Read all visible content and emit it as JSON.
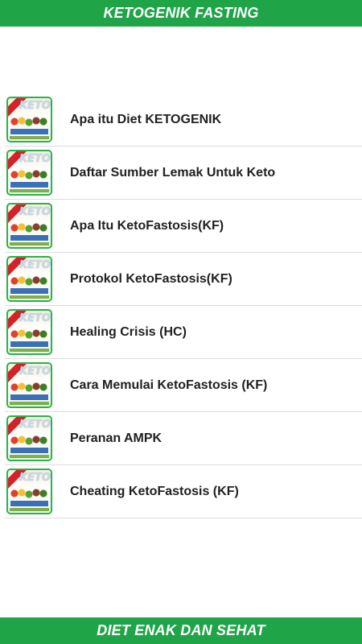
{
  "header": {
    "title": "KETOGENIK FASTING"
  },
  "menu": {
    "items": [
      {
        "label": "Apa itu Diet KETOGENIK"
      },
      {
        "label": "Daftar Sumber Lemak Untuk Keto"
      },
      {
        "label": "Apa Itu KetoFastosis(KF)"
      },
      {
        "label": "Protokol KetoFastosis(KF)"
      },
      {
        "label": "Healing Crisis (HC)"
      },
      {
        "label": "Cara Memulai KetoFastosis (KF)"
      },
      {
        "label": "Peranan AMPK"
      },
      {
        "label": "Cheating KetoFastosis (KF)"
      }
    ],
    "item_icon": "keto-fasting-app-icon"
  },
  "footer": {
    "text": "DIET ENAK DAN SEHAT"
  },
  "colors": {
    "bar": "#1fa447",
    "icon_border": "#2bb24c",
    "text": "#212121"
  }
}
